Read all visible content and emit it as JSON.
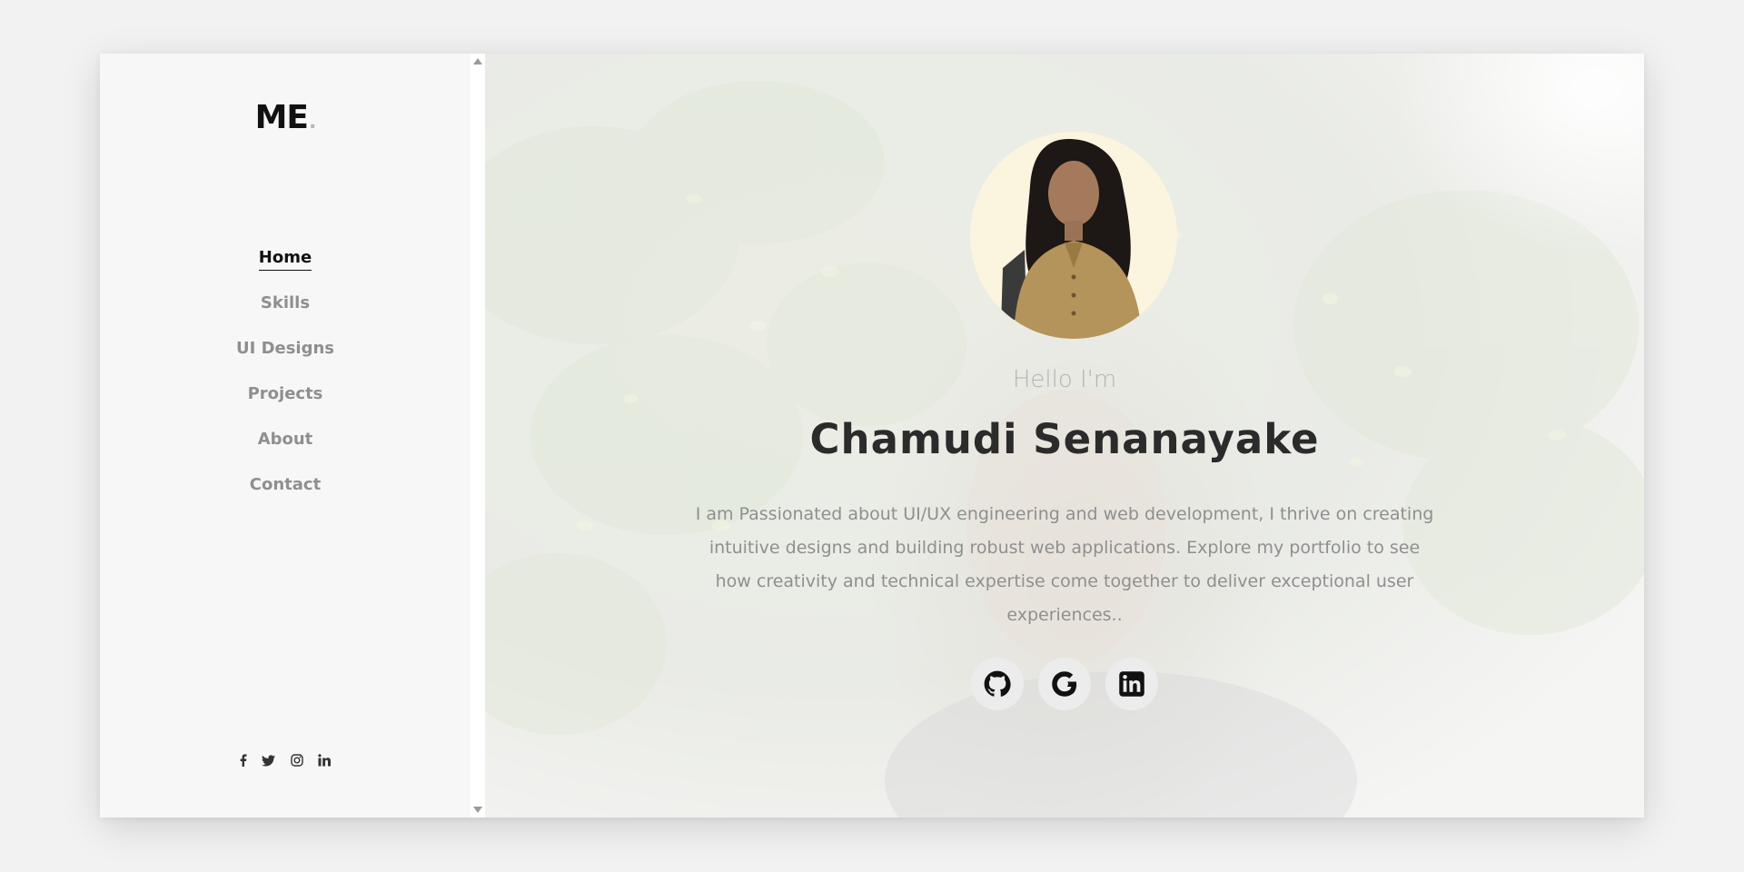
{
  "sidebar": {
    "logo": "ME",
    "logo_dot": ".",
    "nav": [
      "Home",
      "Skills",
      "UI Designs",
      "Projects",
      "About",
      "Contact"
    ],
    "active_item": "Home",
    "social_icons": [
      "facebook-icon",
      "twitter-icon",
      "instagram-icon",
      "linkedin-icon"
    ]
  },
  "hero": {
    "greeting": "Hello I'm",
    "name": "Chamudi Senanayake",
    "bio": "I am Passionated about UI/UX engineering and web development, I thrive on creating intuitive designs and building robust web applications. Explore my portfolio to see how creativity and technical expertise come together to deliver exceptional user experiences..",
    "links": [
      "github-icon",
      "google-icon",
      "linkedin-icon"
    ]
  },
  "colors": {
    "sidebar_bg": "#f7f7f7",
    "active_text": "#111111",
    "muted_text": "#8f8f8f",
    "name_text": "#2b2b2b"
  }
}
